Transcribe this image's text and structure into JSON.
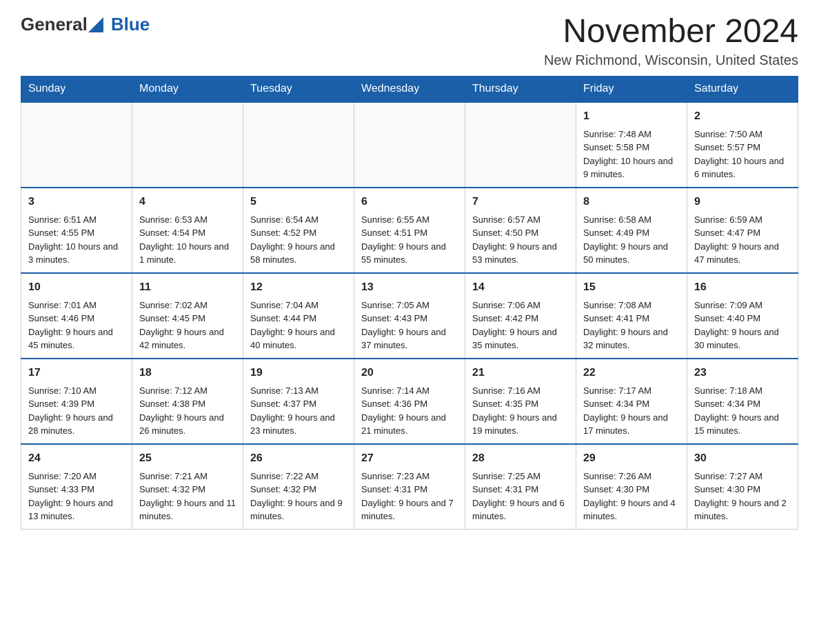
{
  "header": {
    "logo_general": "General",
    "logo_blue": "Blue",
    "month_title": "November 2024",
    "location": "New Richmond, Wisconsin, United States"
  },
  "days_of_week": [
    "Sunday",
    "Monday",
    "Tuesday",
    "Wednesday",
    "Thursday",
    "Friday",
    "Saturday"
  ],
  "weeks": [
    [
      {
        "day": "",
        "sunrise": "",
        "sunset": "",
        "daylight": "",
        "empty": true
      },
      {
        "day": "",
        "sunrise": "",
        "sunset": "",
        "daylight": "",
        "empty": true
      },
      {
        "day": "",
        "sunrise": "",
        "sunset": "",
        "daylight": "",
        "empty": true
      },
      {
        "day": "",
        "sunrise": "",
        "sunset": "",
        "daylight": "",
        "empty": true
      },
      {
        "day": "",
        "sunrise": "",
        "sunset": "",
        "daylight": "",
        "empty": true
      },
      {
        "day": "1",
        "sunrise": "Sunrise: 7:48 AM",
        "sunset": "Sunset: 5:58 PM",
        "daylight": "Daylight: 10 hours and 9 minutes.",
        "empty": false
      },
      {
        "day": "2",
        "sunrise": "Sunrise: 7:50 AM",
        "sunset": "Sunset: 5:57 PM",
        "daylight": "Daylight: 10 hours and 6 minutes.",
        "empty": false
      }
    ],
    [
      {
        "day": "3",
        "sunrise": "Sunrise: 6:51 AM",
        "sunset": "Sunset: 4:55 PM",
        "daylight": "Daylight: 10 hours and 3 minutes.",
        "empty": false
      },
      {
        "day": "4",
        "sunrise": "Sunrise: 6:53 AM",
        "sunset": "Sunset: 4:54 PM",
        "daylight": "Daylight: 10 hours and 1 minute.",
        "empty": false
      },
      {
        "day": "5",
        "sunrise": "Sunrise: 6:54 AM",
        "sunset": "Sunset: 4:52 PM",
        "daylight": "Daylight: 9 hours and 58 minutes.",
        "empty": false
      },
      {
        "day": "6",
        "sunrise": "Sunrise: 6:55 AM",
        "sunset": "Sunset: 4:51 PM",
        "daylight": "Daylight: 9 hours and 55 minutes.",
        "empty": false
      },
      {
        "day": "7",
        "sunrise": "Sunrise: 6:57 AM",
        "sunset": "Sunset: 4:50 PM",
        "daylight": "Daylight: 9 hours and 53 minutes.",
        "empty": false
      },
      {
        "day": "8",
        "sunrise": "Sunrise: 6:58 AM",
        "sunset": "Sunset: 4:49 PM",
        "daylight": "Daylight: 9 hours and 50 minutes.",
        "empty": false
      },
      {
        "day": "9",
        "sunrise": "Sunrise: 6:59 AM",
        "sunset": "Sunset: 4:47 PM",
        "daylight": "Daylight: 9 hours and 47 minutes.",
        "empty": false
      }
    ],
    [
      {
        "day": "10",
        "sunrise": "Sunrise: 7:01 AM",
        "sunset": "Sunset: 4:46 PM",
        "daylight": "Daylight: 9 hours and 45 minutes.",
        "empty": false
      },
      {
        "day": "11",
        "sunrise": "Sunrise: 7:02 AM",
        "sunset": "Sunset: 4:45 PM",
        "daylight": "Daylight: 9 hours and 42 minutes.",
        "empty": false
      },
      {
        "day": "12",
        "sunrise": "Sunrise: 7:04 AM",
        "sunset": "Sunset: 4:44 PM",
        "daylight": "Daylight: 9 hours and 40 minutes.",
        "empty": false
      },
      {
        "day": "13",
        "sunrise": "Sunrise: 7:05 AM",
        "sunset": "Sunset: 4:43 PM",
        "daylight": "Daylight: 9 hours and 37 minutes.",
        "empty": false
      },
      {
        "day": "14",
        "sunrise": "Sunrise: 7:06 AM",
        "sunset": "Sunset: 4:42 PM",
        "daylight": "Daylight: 9 hours and 35 minutes.",
        "empty": false
      },
      {
        "day": "15",
        "sunrise": "Sunrise: 7:08 AM",
        "sunset": "Sunset: 4:41 PM",
        "daylight": "Daylight: 9 hours and 32 minutes.",
        "empty": false
      },
      {
        "day": "16",
        "sunrise": "Sunrise: 7:09 AM",
        "sunset": "Sunset: 4:40 PM",
        "daylight": "Daylight: 9 hours and 30 minutes.",
        "empty": false
      }
    ],
    [
      {
        "day": "17",
        "sunrise": "Sunrise: 7:10 AM",
        "sunset": "Sunset: 4:39 PM",
        "daylight": "Daylight: 9 hours and 28 minutes.",
        "empty": false
      },
      {
        "day": "18",
        "sunrise": "Sunrise: 7:12 AM",
        "sunset": "Sunset: 4:38 PM",
        "daylight": "Daylight: 9 hours and 26 minutes.",
        "empty": false
      },
      {
        "day": "19",
        "sunrise": "Sunrise: 7:13 AM",
        "sunset": "Sunset: 4:37 PM",
        "daylight": "Daylight: 9 hours and 23 minutes.",
        "empty": false
      },
      {
        "day": "20",
        "sunrise": "Sunrise: 7:14 AM",
        "sunset": "Sunset: 4:36 PM",
        "daylight": "Daylight: 9 hours and 21 minutes.",
        "empty": false
      },
      {
        "day": "21",
        "sunrise": "Sunrise: 7:16 AM",
        "sunset": "Sunset: 4:35 PM",
        "daylight": "Daylight: 9 hours and 19 minutes.",
        "empty": false
      },
      {
        "day": "22",
        "sunrise": "Sunrise: 7:17 AM",
        "sunset": "Sunset: 4:34 PM",
        "daylight": "Daylight: 9 hours and 17 minutes.",
        "empty": false
      },
      {
        "day": "23",
        "sunrise": "Sunrise: 7:18 AM",
        "sunset": "Sunset: 4:34 PM",
        "daylight": "Daylight: 9 hours and 15 minutes.",
        "empty": false
      }
    ],
    [
      {
        "day": "24",
        "sunrise": "Sunrise: 7:20 AM",
        "sunset": "Sunset: 4:33 PM",
        "daylight": "Daylight: 9 hours and 13 minutes.",
        "empty": false
      },
      {
        "day": "25",
        "sunrise": "Sunrise: 7:21 AM",
        "sunset": "Sunset: 4:32 PM",
        "daylight": "Daylight: 9 hours and 11 minutes.",
        "empty": false
      },
      {
        "day": "26",
        "sunrise": "Sunrise: 7:22 AM",
        "sunset": "Sunset: 4:32 PM",
        "daylight": "Daylight: 9 hours and 9 minutes.",
        "empty": false
      },
      {
        "day": "27",
        "sunrise": "Sunrise: 7:23 AM",
        "sunset": "Sunset: 4:31 PM",
        "daylight": "Daylight: 9 hours and 7 minutes.",
        "empty": false
      },
      {
        "day": "28",
        "sunrise": "Sunrise: 7:25 AM",
        "sunset": "Sunset: 4:31 PM",
        "daylight": "Daylight: 9 hours and 6 minutes.",
        "empty": false
      },
      {
        "day": "29",
        "sunrise": "Sunrise: 7:26 AM",
        "sunset": "Sunset: 4:30 PM",
        "daylight": "Daylight: 9 hours and 4 minutes.",
        "empty": false
      },
      {
        "day": "30",
        "sunrise": "Sunrise: 7:27 AM",
        "sunset": "Sunset: 4:30 PM",
        "daylight": "Daylight: 9 hours and 2 minutes.",
        "empty": false
      }
    ]
  ]
}
